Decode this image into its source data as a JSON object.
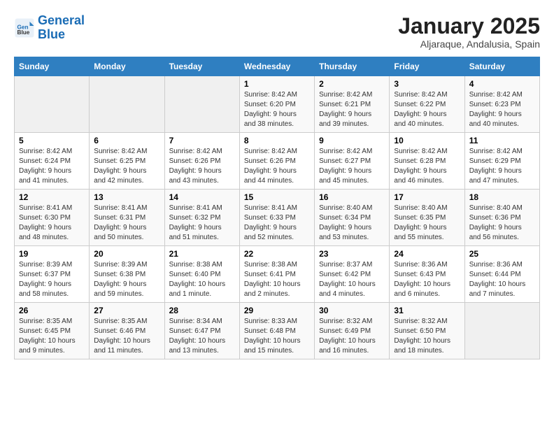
{
  "logo": {
    "line1": "General",
    "line2": "Blue"
  },
  "title": "January 2025",
  "subtitle": "Aljaraque, Andalusia, Spain",
  "days_of_week": [
    "Sunday",
    "Monday",
    "Tuesday",
    "Wednesday",
    "Thursday",
    "Friday",
    "Saturday"
  ],
  "weeks": [
    [
      {
        "day": "",
        "info": ""
      },
      {
        "day": "",
        "info": ""
      },
      {
        "day": "",
        "info": ""
      },
      {
        "day": "1",
        "info": "Sunrise: 8:42 AM\nSunset: 6:20 PM\nDaylight: 9 hours\nand 38 minutes."
      },
      {
        "day": "2",
        "info": "Sunrise: 8:42 AM\nSunset: 6:21 PM\nDaylight: 9 hours\nand 39 minutes."
      },
      {
        "day": "3",
        "info": "Sunrise: 8:42 AM\nSunset: 6:22 PM\nDaylight: 9 hours\nand 40 minutes."
      },
      {
        "day": "4",
        "info": "Sunrise: 8:42 AM\nSunset: 6:23 PM\nDaylight: 9 hours\nand 40 minutes."
      }
    ],
    [
      {
        "day": "5",
        "info": "Sunrise: 8:42 AM\nSunset: 6:24 PM\nDaylight: 9 hours\nand 41 minutes."
      },
      {
        "day": "6",
        "info": "Sunrise: 8:42 AM\nSunset: 6:25 PM\nDaylight: 9 hours\nand 42 minutes."
      },
      {
        "day": "7",
        "info": "Sunrise: 8:42 AM\nSunset: 6:26 PM\nDaylight: 9 hours\nand 43 minutes."
      },
      {
        "day": "8",
        "info": "Sunrise: 8:42 AM\nSunset: 6:26 PM\nDaylight: 9 hours\nand 44 minutes."
      },
      {
        "day": "9",
        "info": "Sunrise: 8:42 AM\nSunset: 6:27 PM\nDaylight: 9 hours\nand 45 minutes."
      },
      {
        "day": "10",
        "info": "Sunrise: 8:42 AM\nSunset: 6:28 PM\nDaylight: 9 hours\nand 46 minutes."
      },
      {
        "day": "11",
        "info": "Sunrise: 8:42 AM\nSunset: 6:29 PM\nDaylight: 9 hours\nand 47 minutes."
      }
    ],
    [
      {
        "day": "12",
        "info": "Sunrise: 8:41 AM\nSunset: 6:30 PM\nDaylight: 9 hours\nand 48 minutes."
      },
      {
        "day": "13",
        "info": "Sunrise: 8:41 AM\nSunset: 6:31 PM\nDaylight: 9 hours\nand 50 minutes."
      },
      {
        "day": "14",
        "info": "Sunrise: 8:41 AM\nSunset: 6:32 PM\nDaylight: 9 hours\nand 51 minutes."
      },
      {
        "day": "15",
        "info": "Sunrise: 8:41 AM\nSunset: 6:33 PM\nDaylight: 9 hours\nand 52 minutes."
      },
      {
        "day": "16",
        "info": "Sunrise: 8:40 AM\nSunset: 6:34 PM\nDaylight: 9 hours\nand 53 minutes."
      },
      {
        "day": "17",
        "info": "Sunrise: 8:40 AM\nSunset: 6:35 PM\nDaylight: 9 hours\nand 55 minutes."
      },
      {
        "day": "18",
        "info": "Sunrise: 8:40 AM\nSunset: 6:36 PM\nDaylight: 9 hours\nand 56 minutes."
      }
    ],
    [
      {
        "day": "19",
        "info": "Sunrise: 8:39 AM\nSunset: 6:37 PM\nDaylight: 9 hours\nand 58 minutes."
      },
      {
        "day": "20",
        "info": "Sunrise: 8:39 AM\nSunset: 6:38 PM\nDaylight: 9 hours\nand 59 minutes."
      },
      {
        "day": "21",
        "info": "Sunrise: 8:38 AM\nSunset: 6:40 PM\nDaylight: 10 hours\nand 1 minute."
      },
      {
        "day": "22",
        "info": "Sunrise: 8:38 AM\nSunset: 6:41 PM\nDaylight: 10 hours\nand 2 minutes."
      },
      {
        "day": "23",
        "info": "Sunrise: 8:37 AM\nSunset: 6:42 PM\nDaylight: 10 hours\nand 4 minutes."
      },
      {
        "day": "24",
        "info": "Sunrise: 8:36 AM\nSunset: 6:43 PM\nDaylight: 10 hours\nand 6 minutes."
      },
      {
        "day": "25",
        "info": "Sunrise: 8:36 AM\nSunset: 6:44 PM\nDaylight: 10 hours\nand 7 minutes."
      }
    ],
    [
      {
        "day": "26",
        "info": "Sunrise: 8:35 AM\nSunset: 6:45 PM\nDaylight: 10 hours\nand 9 minutes."
      },
      {
        "day": "27",
        "info": "Sunrise: 8:35 AM\nSunset: 6:46 PM\nDaylight: 10 hours\nand 11 minutes."
      },
      {
        "day": "28",
        "info": "Sunrise: 8:34 AM\nSunset: 6:47 PM\nDaylight: 10 hours\nand 13 minutes."
      },
      {
        "day": "29",
        "info": "Sunrise: 8:33 AM\nSunset: 6:48 PM\nDaylight: 10 hours\nand 15 minutes."
      },
      {
        "day": "30",
        "info": "Sunrise: 8:32 AM\nSunset: 6:49 PM\nDaylight: 10 hours\nand 16 minutes."
      },
      {
        "day": "31",
        "info": "Sunrise: 8:32 AM\nSunset: 6:50 PM\nDaylight: 10 hours\nand 18 minutes."
      },
      {
        "day": "",
        "info": ""
      }
    ]
  ]
}
